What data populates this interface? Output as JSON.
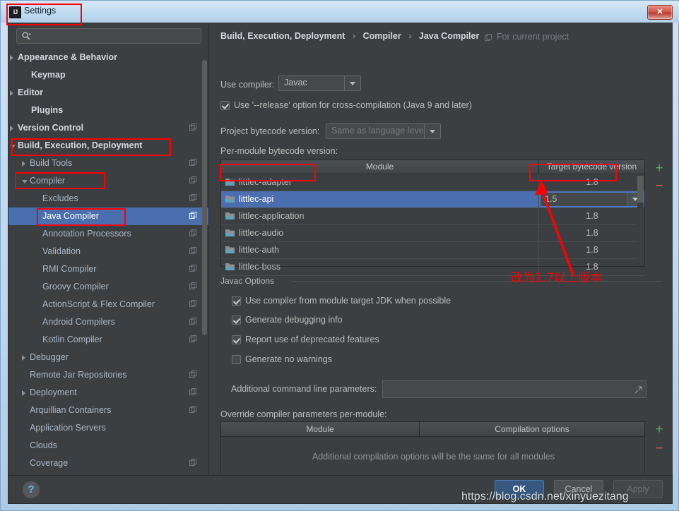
{
  "window": {
    "title": "Settings",
    "icon": "intellij-idea-icon",
    "close_label": "✕"
  },
  "sidebar": {
    "search": {
      "value": "",
      "placeholder": "",
      "icon": "search-icon"
    },
    "items": [
      {
        "label": "Appearance & Behavior",
        "indent": 13,
        "arrow": "right",
        "bold": true,
        "copy": false,
        "selected": false
      },
      {
        "label": "Keymap",
        "indent": 32,
        "arrow": "none",
        "bold": true,
        "copy": false,
        "selected": false
      },
      {
        "label": "Editor",
        "indent": 13,
        "arrow": "right",
        "bold": true,
        "copy": false,
        "selected": false
      },
      {
        "label": "Plugins",
        "indent": 32,
        "arrow": "none",
        "bold": true,
        "copy": false,
        "selected": false
      },
      {
        "label": "Version Control",
        "indent": 13,
        "arrow": "right",
        "bold": true,
        "copy": true,
        "selected": false
      },
      {
        "label": "Build, Execution, Deployment",
        "indent": 13,
        "arrow": "down",
        "bold": true,
        "copy": false,
        "selected": false
      },
      {
        "label": "Build Tools",
        "indent": 30,
        "arrow": "right",
        "bold": false,
        "copy": true,
        "selected": false
      },
      {
        "label": "Compiler",
        "indent": 30,
        "arrow": "down",
        "bold": false,
        "copy": true,
        "selected": false
      },
      {
        "label": "Excludes",
        "indent": 48,
        "arrow": "none",
        "bold": false,
        "copy": true,
        "selected": false
      },
      {
        "label": "Java Compiler",
        "indent": 48,
        "arrow": "none",
        "bold": false,
        "copy": true,
        "selected": true
      },
      {
        "label": "Annotation Processors",
        "indent": 48,
        "arrow": "none",
        "bold": false,
        "copy": true,
        "selected": false
      },
      {
        "label": "Validation",
        "indent": 48,
        "arrow": "none",
        "bold": false,
        "copy": true,
        "selected": false
      },
      {
        "label": "RMI Compiler",
        "indent": 48,
        "arrow": "none",
        "bold": false,
        "copy": true,
        "selected": false
      },
      {
        "label": "Groovy Compiler",
        "indent": 48,
        "arrow": "none",
        "bold": false,
        "copy": true,
        "selected": false
      },
      {
        "label": "ActionScript & Flex Compiler",
        "indent": 48,
        "arrow": "none",
        "bold": false,
        "copy": true,
        "selected": false
      },
      {
        "label": "Android Compilers",
        "indent": 48,
        "arrow": "none",
        "bold": false,
        "copy": true,
        "selected": false
      },
      {
        "label": "Kotlin Compiler",
        "indent": 48,
        "arrow": "none",
        "bold": false,
        "copy": true,
        "selected": false
      },
      {
        "label": "Debugger",
        "indent": 30,
        "arrow": "right",
        "bold": false,
        "copy": false,
        "selected": false
      },
      {
        "label": "Remote Jar Repositories",
        "indent": 30,
        "arrow": "none",
        "bold": false,
        "copy": true,
        "selected": false
      },
      {
        "label": "Deployment",
        "indent": 30,
        "arrow": "right",
        "bold": false,
        "copy": true,
        "selected": false
      },
      {
        "label": "Arquillian Containers",
        "indent": 30,
        "arrow": "none",
        "bold": false,
        "copy": true,
        "selected": false
      },
      {
        "label": "Application Servers",
        "indent": 30,
        "arrow": "none",
        "bold": false,
        "copy": false,
        "selected": false
      },
      {
        "label": "Clouds",
        "indent": 30,
        "arrow": "none",
        "bold": false,
        "copy": false,
        "selected": false
      },
      {
        "label": "Coverage",
        "indent": 30,
        "arrow": "none",
        "bold": false,
        "copy": true,
        "selected": false
      }
    ]
  },
  "main": {
    "breadcrumb": {
      "part1": "Build, Execution, Deployment",
      "part2": "Compiler",
      "part3": "Java Compiler",
      "separator": "›",
      "scope_label": "For current project",
      "scope_icon": "copy-settings-icon"
    },
    "use_compiler": {
      "label": "Use compiler:",
      "value": "Javac"
    },
    "release_option": {
      "label": "Use '--release' option for cross-compilation (Java 9 and later)",
      "checked": true
    },
    "project_bytecode": {
      "label": "Project bytecode version:",
      "value": "Same as language leve",
      "disabled": true
    },
    "per_module": {
      "label": "Per-module bytecode version:",
      "columns": [
        "Module",
        "Target bytecode version"
      ],
      "rows": [
        {
          "module": "littlec-adapter",
          "version": "1.8",
          "selected": false,
          "editing": false
        },
        {
          "module": "littlec-api",
          "version": "1.5",
          "selected": true,
          "editing": true
        },
        {
          "module": "littlec-application",
          "version": "1.8",
          "selected": false,
          "editing": false
        },
        {
          "module": "littlec-audio",
          "version": "1.8",
          "selected": false,
          "editing": false
        },
        {
          "module": "littlec-auth",
          "version": "1.8",
          "selected": false,
          "editing": false
        },
        {
          "module": "littlec-boss",
          "version": "1.8",
          "selected": false,
          "editing": false
        }
      ],
      "add_label": "+",
      "remove_label": "−"
    },
    "javac_options": {
      "title": "Javac Options",
      "checkboxes": [
        {
          "label": "Use compiler from module target JDK when possible",
          "checked": true
        },
        {
          "label": "Generate debugging info",
          "checked": true
        },
        {
          "label": "Report use of deprecated features",
          "checked": true
        },
        {
          "label": "Generate no warnings",
          "checked": false
        }
      ],
      "params": {
        "label": "Additional command line parameters:",
        "value": "",
        "expand_icon": "expand-icon"
      }
    },
    "override": {
      "label": "Override compiler parameters per-module:",
      "columns": [
        "Module",
        "Compilation options"
      ],
      "empty_text": "Additional compilation options will be the same for all modules",
      "add_label": "+",
      "remove_label": "−"
    }
  },
  "footer": {
    "help_label": "?",
    "ok_label": "OK",
    "cancel_label": "Cancel",
    "apply_label": "Apply"
  },
  "annotations": {
    "note_text": "改为1.7以上版本",
    "watermark": "https://blog.csdn.net/xinyuezitang",
    "highlight_color": "#ff0000"
  }
}
